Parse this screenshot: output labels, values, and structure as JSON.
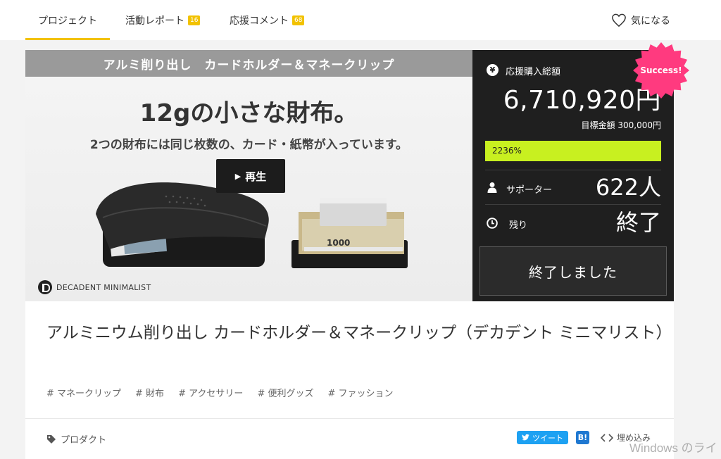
{
  "tabs": [
    {
      "label": "プロジェクト",
      "active": true
    },
    {
      "label": "活動レポート",
      "count": "16"
    },
    {
      "label": "応援コメント",
      "count": "68"
    }
  ],
  "favorite": {
    "label": "気になる",
    "icon": "heart-icon"
  },
  "hero": {
    "banner": "アルミ削り出し　カードホルダー＆マネークリップ",
    "headline": "12gの小さな財布。",
    "subline": "2つの財布には同じ枚数の、カード・紙幣が入っています。",
    "play_label": "再生",
    "brand": "DECADENT MINIMALIST"
  },
  "stats": {
    "amount_label": "応援購入総額",
    "amount": "6,710,920円",
    "goal": "目標金額 300,000円",
    "progress_text": "2236%",
    "progress_fill": 1.0,
    "supporters_label": "サポーター",
    "supporters": "622人",
    "remaining_label": "残り",
    "remaining": "終了",
    "ended_button": "終了しました",
    "badge": "Success!",
    "accent_color": "#c8f020",
    "badge_color": "#ff3a7f"
  },
  "project": {
    "title": "アルミニウム削り出し カードホルダー＆マネークリップ（デカデント ミニマリスト）",
    "tags": [
      "# マネークリップ",
      "# 財布",
      "# アクセサリー",
      "# 便利グッズ",
      "# ファッション"
    ],
    "category": "プロダクト"
  },
  "share": {
    "tweet": "ツイート",
    "hatena": "B!",
    "embed": "埋め込み"
  },
  "os_watermark": "Windows のライ"
}
